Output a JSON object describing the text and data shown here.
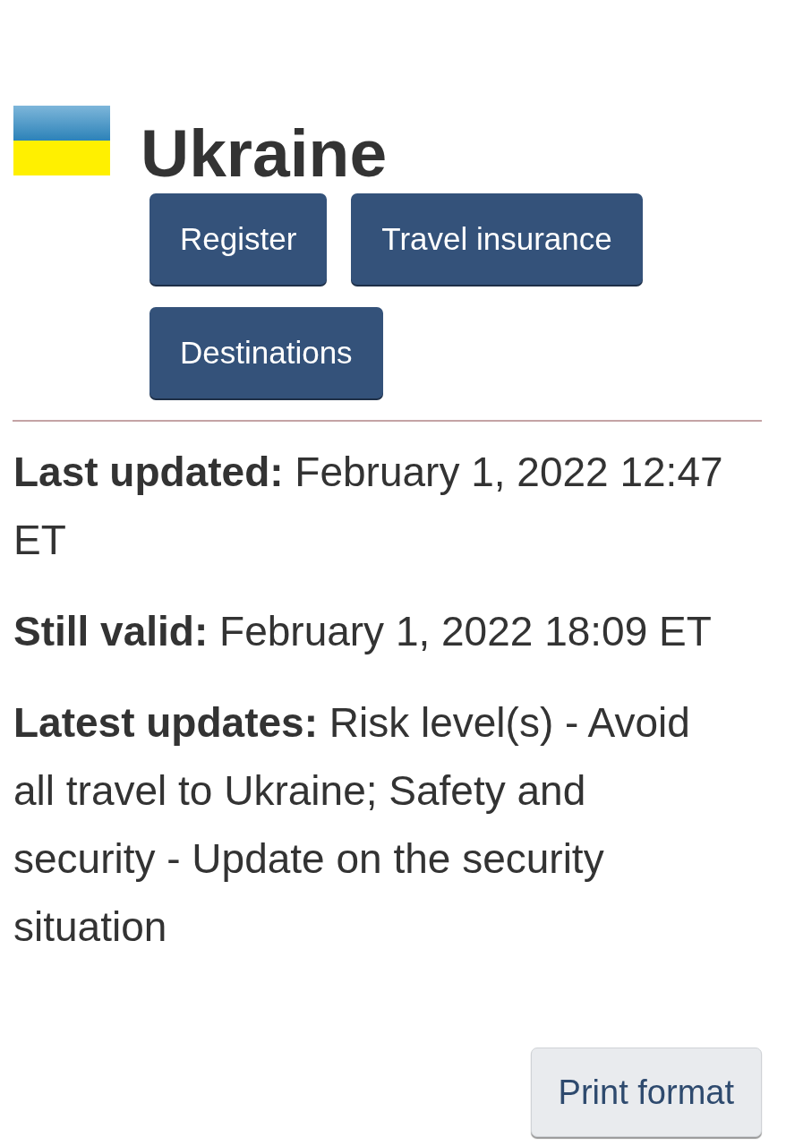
{
  "country": {
    "name": "Ukraine"
  },
  "actions": [
    {
      "label": "Register"
    },
    {
      "label": "Travel insurance"
    },
    {
      "label": "Destinations"
    }
  ],
  "details": [
    {
      "label": "Last updated:",
      "value": "February 1, 2022 12:47 ET"
    },
    {
      "label": "Still valid:",
      "value": "February 1, 2022 18:09 ET"
    },
    {
      "label": "Latest updates:",
      "value": "Risk level(s) - Avoid all travel to Ukraine; Safety and security - Update on the security situation"
    }
  ],
  "print_button": {
    "label": "Print format"
  }
}
